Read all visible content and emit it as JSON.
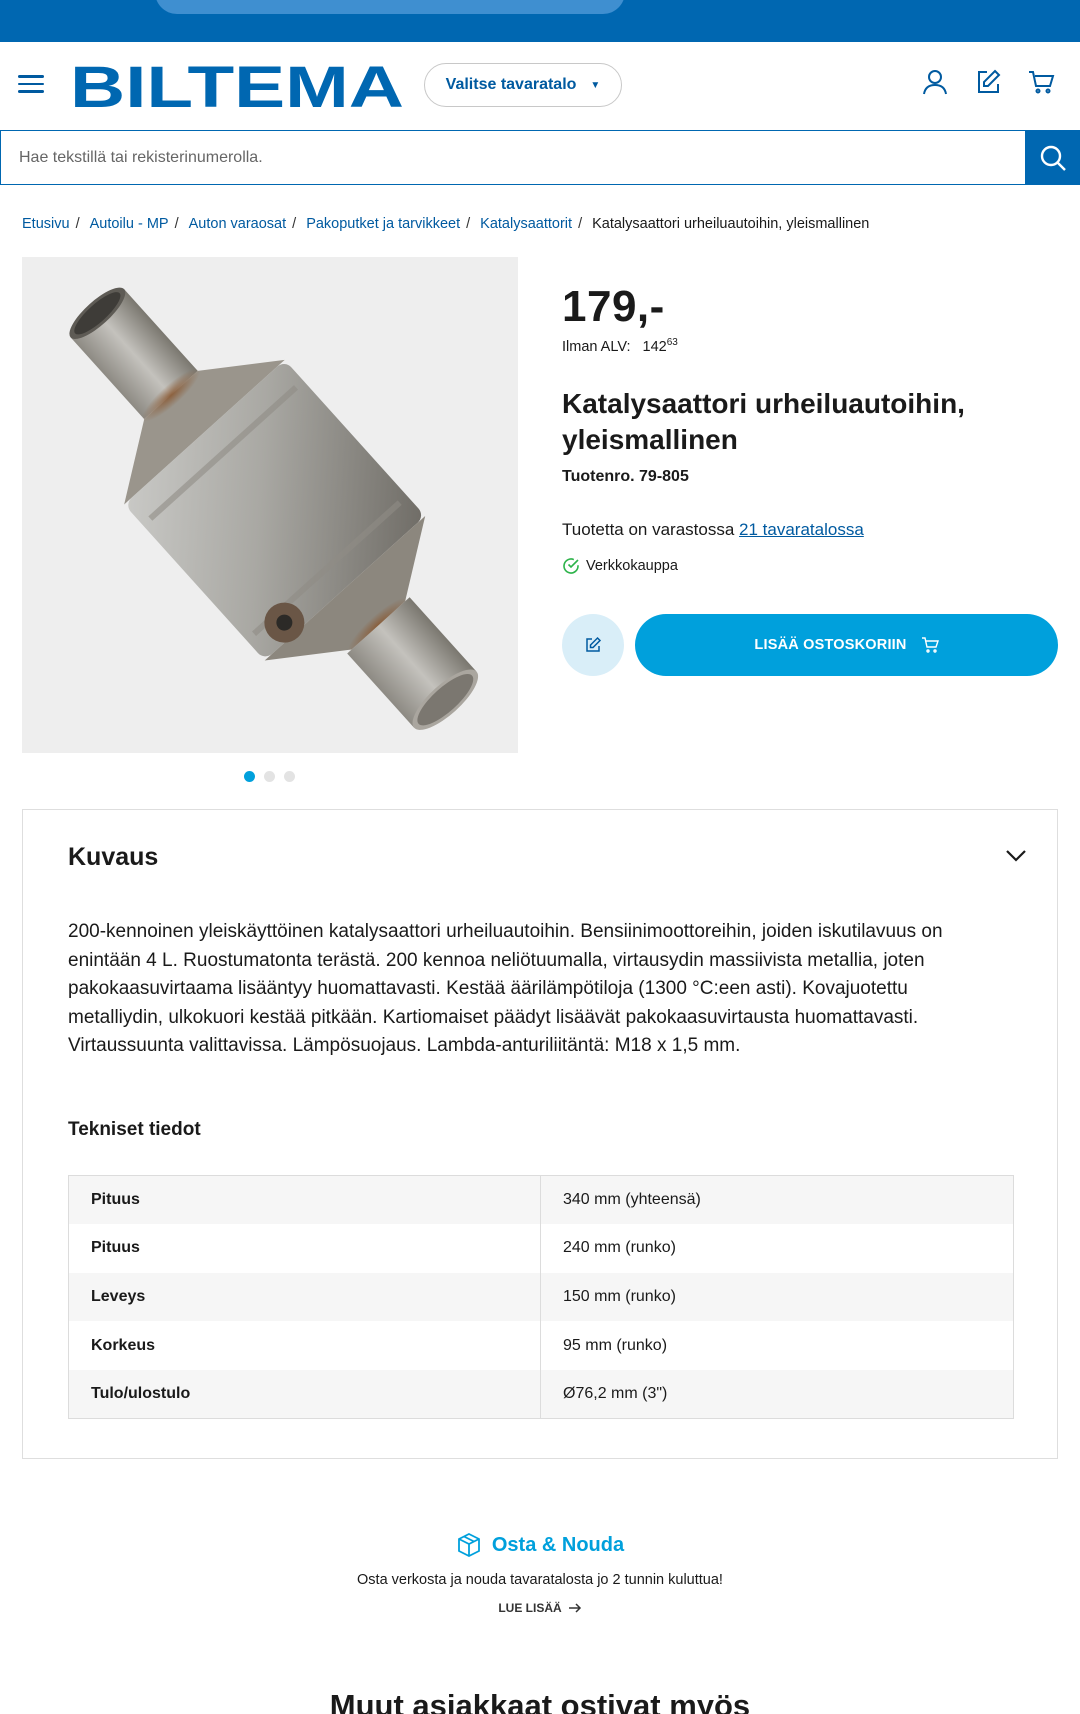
{
  "header": {
    "logo_text": "BILTEMA",
    "store_select_label": "Valitse tavaratalo",
    "icons": [
      "menu-icon",
      "user-icon",
      "edit-list-icon",
      "cart-icon"
    ]
  },
  "search": {
    "placeholder": "Hae tekstillä tai rekisterinumerolla."
  },
  "breadcrumb": {
    "items": [
      "Etusivu",
      "Autoilu - MP",
      "Auton varaosat",
      "Pakoputket ja tarvikkeet",
      "Katalysaattorit"
    ],
    "current": "Katalysaattori urheiluautoihin, yleismallinen"
  },
  "gallery": {
    "image_count": 3,
    "active_index": 0
  },
  "product": {
    "price": "179,-",
    "price_ex_vat_label": "Ilman ALV:",
    "price_ex_vat_main": "142",
    "price_ex_vat_cents": "63",
    "title": "Katalysaattori urheiluautoihin, yleismallinen",
    "sku": "Tuotenro. 79-805",
    "stock_text": "Tuotetta on varastossa",
    "stock_link": "21 tavaratalossa",
    "online_label": "Verkkokauppa",
    "add_to_cart_label": "LISÄÄ OSTOSKORIIN"
  },
  "description": {
    "heading": "Kuvaus",
    "text": "200-kennoinen yleiskäyttöinen katalysaattori urheiluautoihin. Bensiinimoottoreihin, joiden iskutilavuus on enintään 4 L. Ruostumatonta terästä. 200 kennoa neliötuumalla, virtausydin massiivista metallia, joten pakokaasuvirtaama lisääntyy huomattavasti. Kestää äärilämpötiloja (1300 °C:een asti). Kovajuotettu metalliydin, ulkokuori kestää pitkään. Kartiomaiset päädyt lisäävät pakokaasuvirtausta huomattavasti. Virtaussuunta valittavissa. Lämpösuojaus. Lambda-anturiliitäntä: M18 x 1,5 mm.",
    "tech_heading": "Tekniset tiedot",
    "specs": [
      {
        "key": "Pituus",
        "value": "340 mm (yhteensä)"
      },
      {
        "key": "Pituus",
        "value": "240 mm (runko)"
      },
      {
        "key": "Leveys",
        "value": "150 mm (runko)"
      },
      {
        "key": "Korkeus",
        "value": "95 mm (runko)"
      },
      {
        "key": "Tulo/ulostulo",
        "value": "Ø76,2 mm (3\")"
      }
    ]
  },
  "pickup": {
    "title": "Osta & Nouda",
    "text": "Osta verkosta ja nouda tavaratalosta jo 2 tunnin kuluttua!",
    "link": "LUE LISÄÄ"
  },
  "related": {
    "heading": "Muut asiakkaat ostivat myös"
  },
  "colors": {
    "brand_blue": "#0067b1",
    "accent_cyan": "#00a0dc",
    "success_green": "#2db34a"
  }
}
